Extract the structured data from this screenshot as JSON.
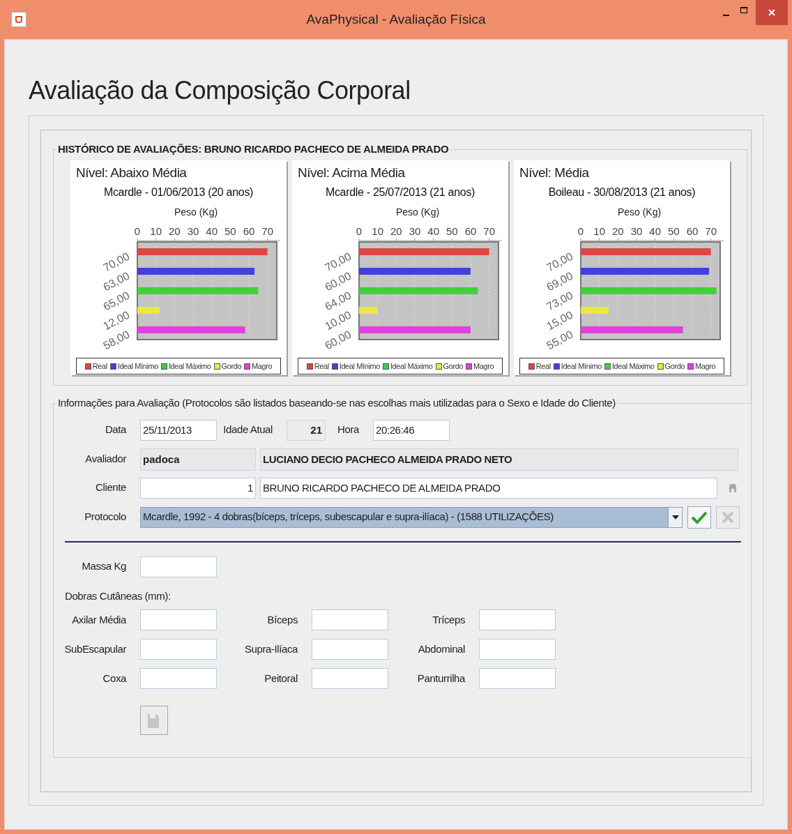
{
  "window": {
    "title": "AvaPhysical - Avaliação Física"
  },
  "heading": "Avaliação da Composição Corporal",
  "history": {
    "legend": "HISTÓRICO DE AVALIAÇÕES: BRUNO RICARDO PACHECO DE ALMEIDA PRADO",
    "charts": [
      {
        "level_text": "Nível: Abaixo Média",
        "chart_data": {
          "type": "bar",
          "orientation": "horizontal",
          "title": "Mcardle - 01/06/2013 (20 anos)",
          "grid": true,
          "legend": "bottom",
          "xlabel": "Peso (Kg)",
          "categories": [
            "70,00",
            "63,00",
            "65,00",
            "12,00",
            "58,00"
          ],
          "xlim": [
            0,
            75
          ],
          "xticks": [
            0,
            10,
            20,
            30,
            40,
            50,
            60,
            70
          ],
          "series": [
            {
              "name": "Real",
              "color": "#e04545",
              "values": [
                70,
                null,
                null,
                null,
                null
              ]
            },
            {
              "name": "Ideal Mínimo",
              "color": "#4040e0",
              "values": [
                null,
                63,
                null,
                null,
                null
              ]
            },
            {
              "name": "Ideal Máximo",
              "color": "#40d040",
              "values": [
                null,
                null,
                65,
                null,
                null
              ]
            },
            {
              "name": "Gordo",
              "color": "#e8e840",
              "values": [
                null,
                null,
                null,
                12,
                null
              ]
            },
            {
              "name": "Magro",
              "color": "#e040e0",
              "values": [
                null,
                null,
                null,
                null,
                58
              ]
            }
          ]
        }
      },
      {
        "level_text": "Nível: Acima Média",
        "chart_data": {
          "type": "bar",
          "orientation": "horizontal",
          "title": "Mcardle - 25/07/2013 (21 anos)",
          "grid": true,
          "legend": "bottom",
          "xlabel": "Peso (Kg)",
          "categories": [
            "70,00",
            "60,00",
            "64,00",
            "10,00",
            "60,00"
          ],
          "xlim": [
            0,
            75
          ],
          "xticks": [
            0,
            10,
            20,
            30,
            40,
            50,
            60,
            70
          ],
          "series": [
            {
              "name": "Real",
              "color": "#e04545",
              "values": [
                70,
                null,
                null,
                null,
                null
              ]
            },
            {
              "name": "Ideal Mínimo",
              "color": "#4040e0",
              "values": [
                null,
                60,
                null,
                null,
                null
              ]
            },
            {
              "name": "Ideal Máximo",
              "color": "#40d040",
              "values": [
                null,
                null,
                64,
                null,
                null
              ]
            },
            {
              "name": "Gordo",
              "color": "#e8e840",
              "values": [
                null,
                null,
                null,
                10,
                null
              ]
            },
            {
              "name": "Magro",
              "color": "#e040e0",
              "values": [
                null,
                null,
                null,
                null,
                60
              ]
            }
          ]
        }
      },
      {
        "level_text": "Nível: Média",
        "chart_data": {
          "type": "bar",
          "orientation": "horizontal",
          "title": "Boileau - 30/08/2013 (21 anos)",
          "grid": true,
          "legend": "bottom",
          "xlabel": "Peso (Kg)",
          "categories": [
            "70,00",
            "69,00",
            "73,00",
            "15,00",
            "55,00"
          ],
          "xlim": [
            0,
            75
          ],
          "xticks": [
            0,
            10,
            20,
            30,
            40,
            50,
            60,
            70
          ],
          "series": [
            {
              "name": "Real",
              "color": "#e04545",
              "values": [
                70,
                null,
                null,
                null,
                null
              ]
            },
            {
              "name": "Ideal Mínimo",
              "color": "#4040e0",
              "values": [
                null,
                69,
                null,
                null,
                null
              ]
            },
            {
              "name": "Ideal Máximo",
              "color": "#40d040",
              "values": [
                null,
                null,
                73,
                null,
                null
              ]
            },
            {
              "name": "Gordo",
              "color": "#e8e840",
              "values": [
                null,
                null,
                null,
                15,
                null
              ]
            },
            {
              "name": "Magro",
              "color": "#e040e0",
              "values": [
                null,
                null,
                null,
                null,
                55
              ]
            }
          ]
        }
      }
    ]
  },
  "form": {
    "legend": "Informações para Avaliação (Protocolos são listados baseando-se nas escolhas mais utilizadas para o Sexo e Idade do Cliente)",
    "date": {
      "label": "Data",
      "value": "25/11/2013"
    },
    "age": {
      "label": "Idade Atual",
      "value": "21"
    },
    "time": {
      "label": "Hora",
      "value": "20:26:46"
    },
    "evaluator": {
      "label": "Avaliador",
      "login": "padoca",
      "name": "LUCIANO DECIO PACHECO ALMEIDA PRADO NETO"
    },
    "client": {
      "label": "Cliente",
      "id": "1",
      "name": "BRUNO RICARDO PACHECO DE ALMEIDA PRADO"
    },
    "protocol": {
      "label": "Protocolo",
      "value": "Mcardle, 1992 - 4 dobras(bíceps, tríceps, subescapular e supra-ilíaca) - (1588 UTILIZAÇÕES)",
      "confirm_disabled": false,
      "cancel_disabled": true
    },
    "mass": {
      "label": "Massa Kg"
    },
    "skinfolds": {
      "title": "Dobras Cutâneas (mm):",
      "fields": [
        {
          "label": "Axilar Média"
        },
        {
          "label": "Bíceps"
        },
        {
          "label": "Tríceps"
        },
        {
          "label": "SubEscapular"
        },
        {
          "label": "Supra-Ilíaca"
        },
        {
          "label": "Abdominal"
        },
        {
          "label": "Coxa"
        },
        {
          "label": "Peitoral"
        },
        {
          "label": "Panturrilha"
        }
      ]
    },
    "save_disabled": true
  }
}
